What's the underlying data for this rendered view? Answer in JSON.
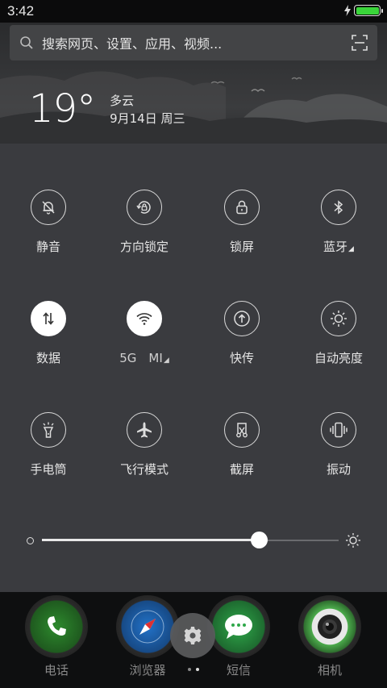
{
  "status_bar": {
    "time": "3:42",
    "battery_level": 1.0,
    "battery_color": "#3ad53a"
  },
  "search": {
    "placeholder": "搜索网页、设置、应用、视频..."
  },
  "weather": {
    "temperature": "19°",
    "condition": "多云",
    "date": "9月14日 周三"
  },
  "toggles": [
    {
      "label": "静音",
      "icon": "mute-bell-icon",
      "active": false
    },
    {
      "label": "方向锁定",
      "icon": "rotation-lock-icon",
      "active": false
    },
    {
      "label": "锁屏",
      "icon": "lock-icon",
      "active": false
    },
    {
      "label": "蓝牙",
      "icon": "bluetooth-icon",
      "active": false,
      "has_menu": true
    },
    {
      "label": "数据",
      "icon": "mobile-data-icon",
      "active": true
    },
    {
      "label": "5G　MI",
      "icon": "wifi-icon",
      "active": true,
      "has_menu": true
    },
    {
      "label": "快传",
      "icon": "quick-transfer-icon",
      "active": false
    },
    {
      "label": "自动亮度",
      "icon": "auto-brightness-icon",
      "active": false
    },
    {
      "label": "手电筒",
      "icon": "flashlight-icon",
      "active": false
    },
    {
      "label": "飞行模式",
      "icon": "airplane-icon",
      "active": false
    },
    {
      "label": "截屏",
      "icon": "screenshot-icon",
      "active": false
    },
    {
      "label": "振动",
      "icon": "vibrate-icon",
      "active": false
    }
  ],
  "brightness": {
    "level": 0.73
  },
  "dock": {
    "apps": [
      {
        "label": "电话",
        "icon": "phone-icon",
        "color": "#2e9a2e"
      },
      {
        "label": "浏览器",
        "icon": "compass-icon",
        "color": "#1f6fc9"
      },
      {
        "label": "短信",
        "icon": "message-icon",
        "color": "#2fa84a"
      },
      {
        "label": "相机",
        "icon": "camera-icon",
        "color": "#4cab4c"
      }
    ],
    "page_count": 2,
    "active_page": 2
  }
}
